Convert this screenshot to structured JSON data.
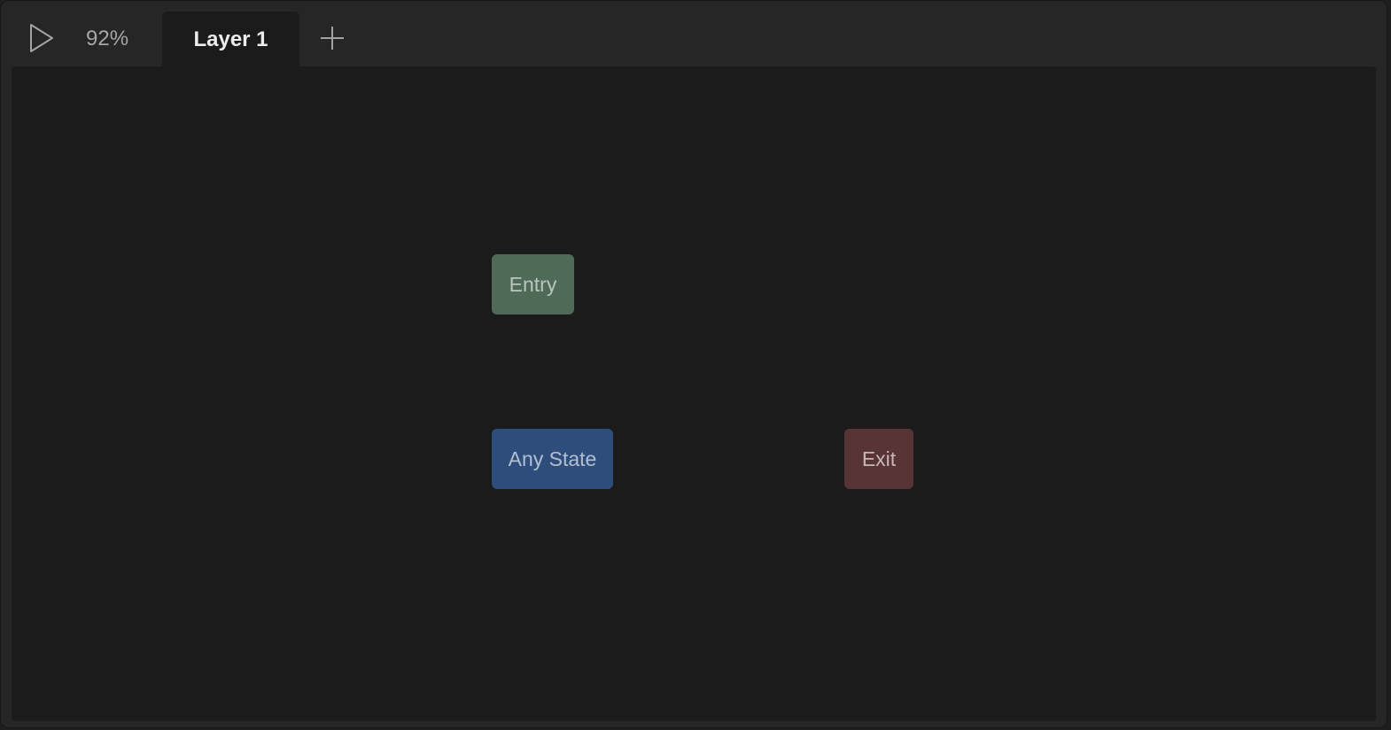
{
  "toolbar": {
    "play_icon": "play-icon",
    "zoom_level": "92%",
    "add_icon": "plus-icon"
  },
  "tabs": [
    {
      "label": "Layer 1",
      "active": true
    }
  ],
  "canvas": {
    "nodes": [
      {
        "label": "Entry",
        "color": "#4f6a57"
      },
      {
        "label": "Any State",
        "color": "#2e4d7b"
      },
      {
        "label": "Exit",
        "color": "#583434"
      }
    ]
  },
  "colors": {
    "window_bg": "#262626",
    "canvas_bg": "#1b1b1b",
    "tab_active_bg": "#1b1b1b",
    "text_primary": "#ececec",
    "text_muted": "#a7a7a7"
  }
}
